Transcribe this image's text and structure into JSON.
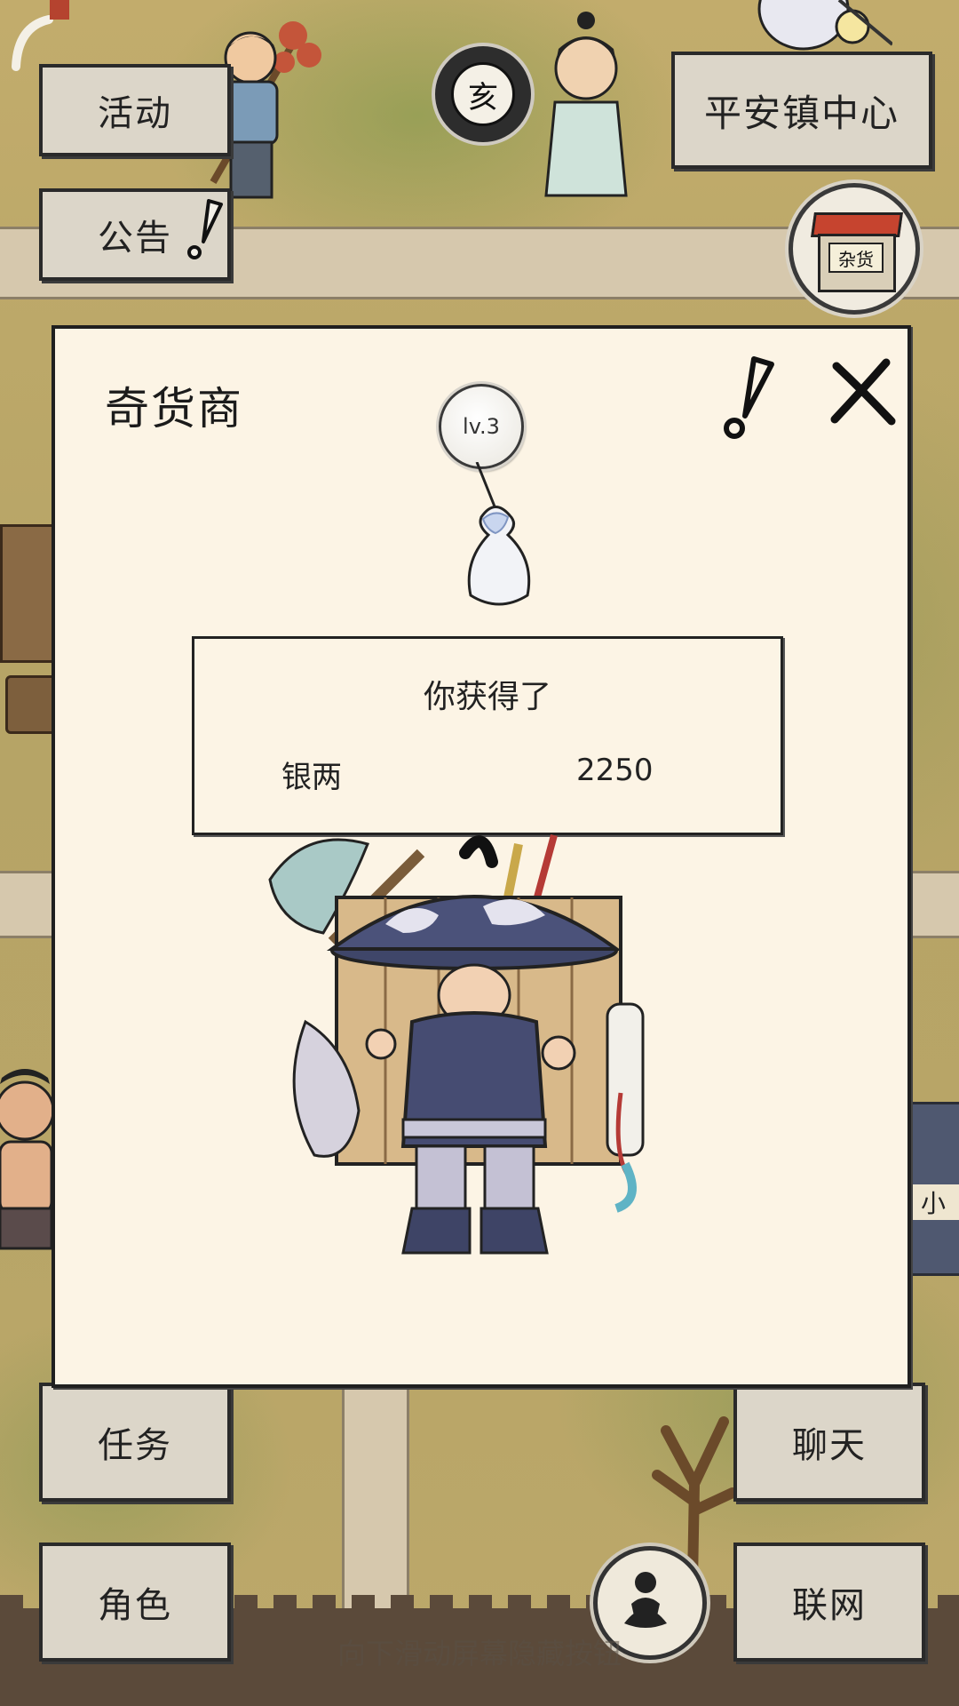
{
  "top_buttons": {
    "activity": "活动",
    "notice": "公告",
    "location": "平安镇中心"
  },
  "bottom_buttons": {
    "task": "任务",
    "role": "角色",
    "chat": "聊天",
    "online": "联网"
  },
  "time_badge": "亥",
  "shop_sign": "杂货",
  "stall_sign": "小",
  "dialog": {
    "title": "奇货商",
    "level": "lv.3",
    "reward": {
      "heading": "你获得了",
      "item_name": "银两",
      "item_value": "2250"
    }
  },
  "hint_text": "向下滑动屏幕隐藏按钮"
}
